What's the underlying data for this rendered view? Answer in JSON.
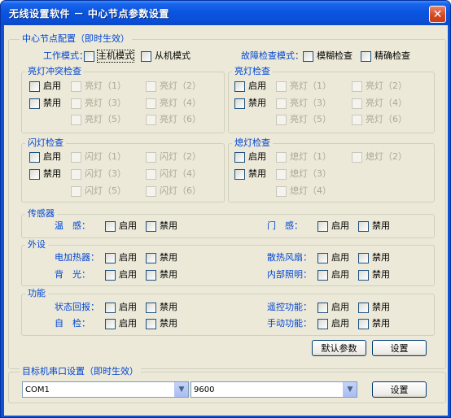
{
  "window": {
    "title": "无线设置软件 － 中心节点参数设置",
    "close_icon": "close-icon"
  },
  "center": {
    "legend": "中心节点配置（即时生效）",
    "work_mode_label": "工作模式：",
    "master_mode": "主机模式",
    "slave_mode": "从机模式",
    "fault_check_label": "故障检查模式：",
    "fuzzy_check": "模糊检查",
    "exact_check": "精确检查"
  },
  "light_conflict": {
    "legend": "亮灯冲突检查",
    "enable": "启用",
    "disable": "禁用",
    "items": [
      "亮灯（1）",
      "亮灯（2）",
      "亮灯（3）",
      "亮灯（4）",
      "亮灯（5）",
      "亮灯（6）"
    ]
  },
  "light_check": {
    "legend": "亮灯检查",
    "enable": "启用",
    "disable": "禁用",
    "items": [
      "亮灯（1）",
      "亮灯（2）",
      "亮灯（3）",
      "亮灯（4）",
      "亮灯（5）",
      "亮灯（6）"
    ]
  },
  "flash_check": {
    "legend": "闪灯检查",
    "enable": "启用",
    "disable": "禁用",
    "items": [
      "闪灯（1）",
      "闪灯（2）",
      "闪灯（3）",
      "闪灯（4）",
      "闪灯（5）",
      "闪灯（6）"
    ]
  },
  "off_check": {
    "legend": "熄灯检查",
    "enable": "启用",
    "disable": "禁用",
    "items": [
      "熄灯（1）",
      "熄灯（2）",
      "熄灯（3）",
      "熄灯（4）"
    ]
  },
  "sensor": {
    "legend": "传感器",
    "temp_label": "温　感：",
    "door_label": "门　感：",
    "enable": "启用",
    "disable": "禁用"
  },
  "peripheral": {
    "legend": "外设",
    "heater_label": "电加热器：",
    "fan_label": "散热风扇：",
    "backlight_label": "背　光：",
    "internal_light_label": "内部照明：",
    "enable": "启用",
    "disable": "禁用"
  },
  "function": {
    "legend": "功能",
    "status_report_label": "状态回报：",
    "remote_label": "遥控功能：",
    "self_test_label": "自　检：",
    "manual_label": "手动功能：",
    "enable": "启用",
    "disable": "禁用"
  },
  "buttons": {
    "default_params": "默认参数",
    "set": "设置"
  },
  "serial": {
    "legend": "目标机串口设置（即时生效）",
    "port_value": "COM1",
    "baud_value": "9600",
    "set": "设置"
  }
}
